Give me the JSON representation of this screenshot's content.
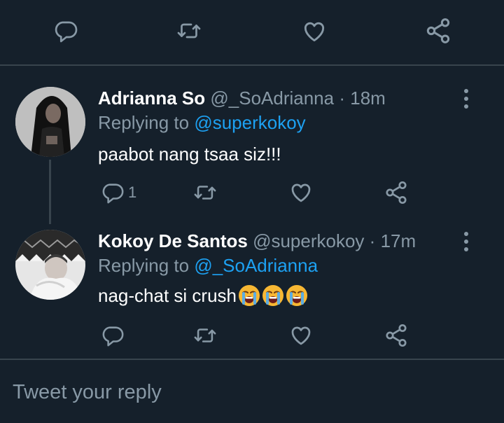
{
  "top_actions": {
    "icons": [
      "reply-icon",
      "retweet-icon",
      "like-icon",
      "share-icon"
    ]
  },
  "tweets": [
    {
      "name": "Adrianna So",
      "handle": "@_SoAdrianna",
      "dot": "·",
      "time": "18m",
      "replying_prefix": "Replying to ",
      "replying_to": "@superkokoy",
      "text": "paabot nang tsaa siz!!!",
      "reply_count": "1",
      "emoji": []
    },
    {
      "name": "Kokoy De Santos",
      "handle": "@superkokoy",
      "dot": "·",
      "time": "17m",
      "replying_prefix": "Replying to ",
      "replying_to": "@_SoAdrianna",
      "text": "nag-chat si crush",
      "reply_count": "",
      "emoji": [
        "loudly-crying-face",
        "loudly-crying-face",
        "loudly-crying-face"
      ]
    }
  ],
  "composer": {
    "placeholder": "Tweet your reply"
  },
  "colors": {
    "background": "#15202b",
    "border": "#38444d",
    "muted": "#8899a6",
    "accent": "#1da1f2",
    "text": "#ffffff"
  }
}
